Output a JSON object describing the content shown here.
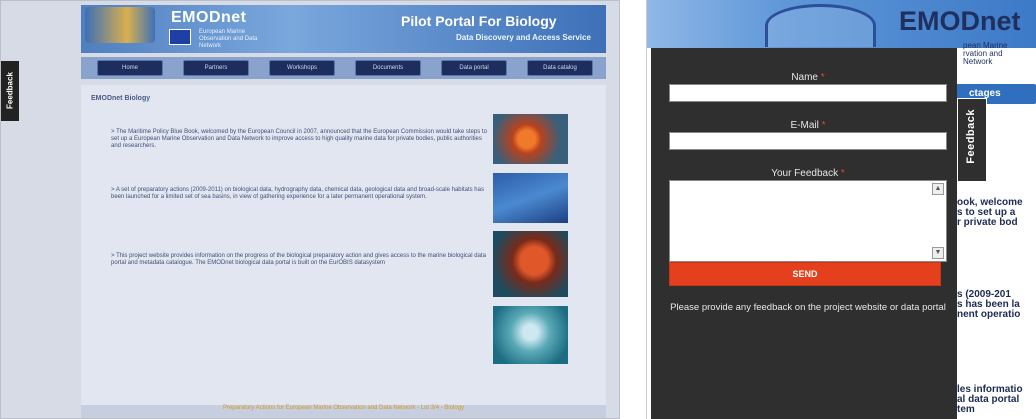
{
  "left": {
    "feedback_tab": "Feedback",
    "brand": "EMODnet",
    "brand_sub": "European Marine Observation and Data Network",
    "portal_title": "Pilot Portal For Biology",
    "portal_sub": "Data Discovery and Access Service",
    "nav": [
      "Home",
      "Partners",
      "Workshops",
      "Documents",
      "Data portal",
      "Data catalog"
    ],
    "section_title": "EMODnet Biology",
    "paragraphs": [
      "> The Maritime Policy Blue Book, welcomed by the European Council in 2007, announced that the European Commission would take steps to set up a European Marine Observation and Data Network to improve access to high quality marine data for private bodies, public authorities and researchers.",
      "> A set of preparatory actions (2009-2011) on biological data, hydrography data, chemical data, geological data and broad-scale habitats has been launched for a limited set of sea basins, in view of gathering experience for a later permanent operational system.",
      "> This project website provides information on the progress of the biological preparatory action and gives access to the marine biological data portal and metadata catalogue. The EMODnet biological data portal is built on the EurOBIS datasystem"
    ],
    "footer": "Preparatory Actions for European Marine Observation and Data Network - Lot 3/4 - Biology"
  },
  "right": {
    "brand": "EMODnet",
    "brand_sub_lines": [
      "pean Marine",
      "rvation and",
      "Network"
    ],
    "nav_label": "ctages",
    "side_text": [
      "ook, welcome",
      "s to set up a",
      "r private bod",
      "s (2009-201",
      "s has been la",
      "nent operatio",
      "les informatio",
      "al data portal",
      "tem"
    ],
    "feedback_form": {
      "name_label": "Name",
      "email_label": "E-Mail",
      "feedback_label": "Your Feedback",
      "required_mark": "*",
      "send_label": "SEND",
      "note": "Please provide any feedback on the project website or data portal"
    },
    "feedback_tab": "Feedback"
  },
  "colors": {
    "send_button": "#e5401d",
    "panel": "#2f2f2f",
    "required": "#e04a27"
  }
}
